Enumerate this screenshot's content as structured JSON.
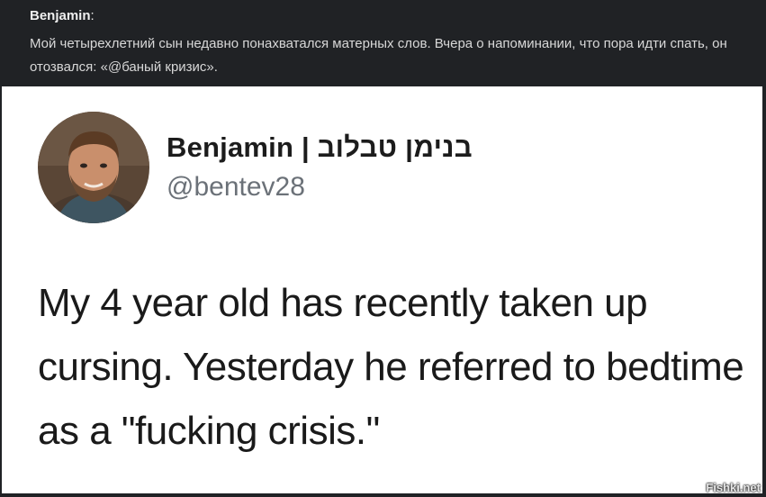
{
  "caption": {
    "author": "Benjamin",
    "colon": ":",
    "text": "Мой четырехлетний сын недавно понахватался матерных слов. Вчера о напоминании, что пора идти спать, он отозвался: «@баный кризис»."
  },
  "tweet": {
    "display_name": "Benjamin  | בנימן טבלוב",
    "handle": "@bentev28",
    "body": "My 4 year old has recently taken up cursing. Yesterday he referred to bedtime as a \"fucking crisis.\""
  },
  "watermark": "Fishki.net"
}
